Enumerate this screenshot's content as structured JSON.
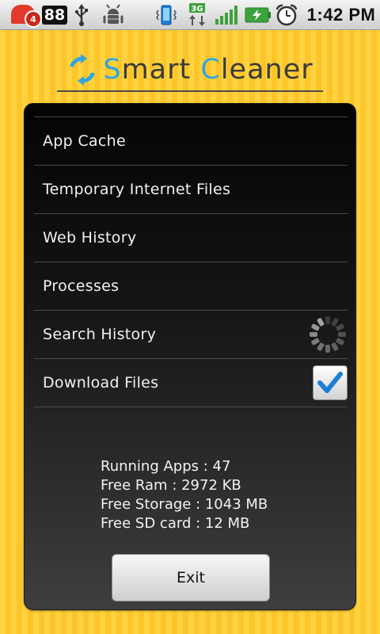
{
  "status_bar": {
    "notification_count": "4",
    "battery_level": "88",
    "time": "1:42 PM",
    "icons": [
      "notification-icon",
      "usb-icon",
      "debug-icon",
      "vibrate-icon",
      "network-3g-icon",
      "signal-icon",
      "battery-charging-icon",
      "alarm-icon"
    ]
  },
  "header": {
    "title_first_letter": "S",
    "title_rest": "mart ",
    "title_second_letter": "C",
    "title_rest2": "leaner"
  },
  "items": [
    {
      "label": "App Cache",
      "state": "none"
    },
    {
      "label": "Temporary Internet Files",
      "state": "none"
    },
    {
      "label": "Web History",
      "state": "none"
    },
    {
      "label": "Processes",
      "state": "none"
    },
    {
      "label": "Search History",
      "state": "loading"
    },
    {
      "label": "Download Files",
      "state": "checked"
    }
  ],
  "stats": {
    "running_apps": "Running Apps : 47",
    "free_ram": "Free Ram : 2972 KB",
    "free_storage": "Free Storage : 1043 MB",
    "free_sd": "Free SD card : 12 MB"
  },
  "exit_label": "Exit",
  "colors": {
    "accent": "#2fa6e0",
    "background": "#ffd23f",
    "panel": "#151515",
    "check": "#1e7fd6"
  }
}
